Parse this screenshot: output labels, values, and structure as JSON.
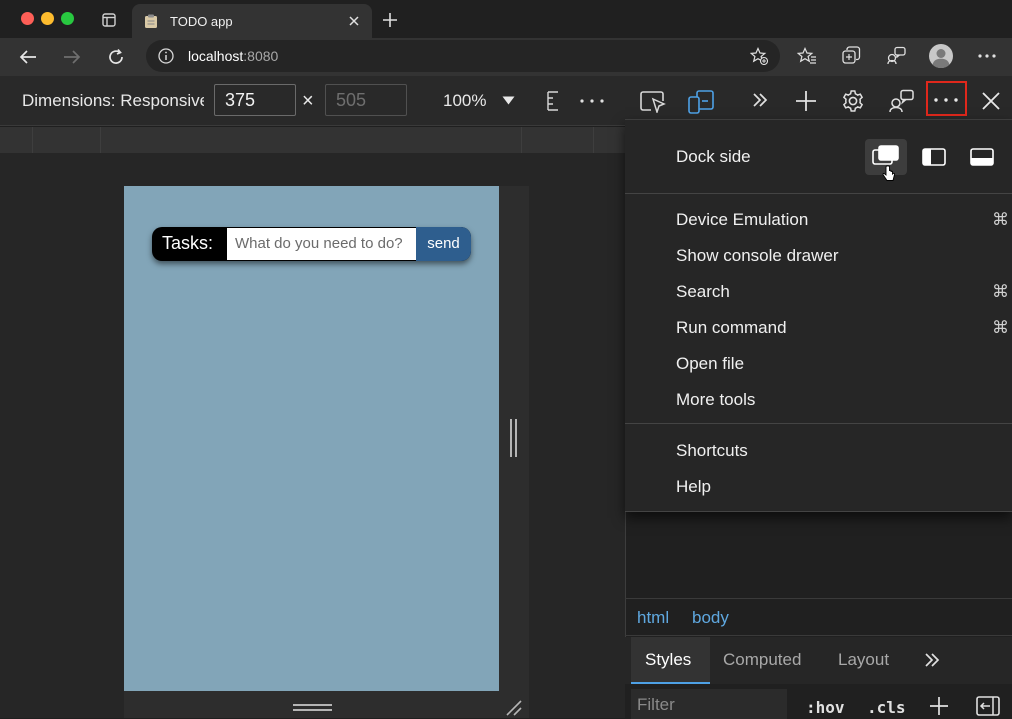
{
  "browser": {
    "tab_title": "TODO app",
    "url_host": "localhost",
    "url_port": ":8080"
  },
  "device_toolbar": {
    "dimensions_label": "Dimensions: Responsive",
    "width_value": "375",
    "height_value": "505",
    "times_symbol": "×",
    "zoom": "100%"
  },
  "app": {
    "tasks_label": "Tasks:",
    "input_placeholder": "What do you need to do?",
    "send_label": "send",
    "background_color": "#82a5b8",
    "send_color": "#2e5e8e"
  },
  "devtools_menu": {
    "dock_side_label": "Dock side",
    "items": [
      {
        "label": "Device Emulation",
        "shortcut": "⌘"
      },
      {
        "label": "Show console drawer",
        "shortcut": ""
      },
      {
        "label": "Search",
        "shortcut": "⌘"
      },
      {
        "label": "Run command",
        "shortcut": "⌘"
      },
      {
        "label": "Open file",
        "shortcut": ""
      },
      {
        "label": "More tools",
        "shortcut": ""
      }
    ],
    "items2": [
      {
        "label": "Shortcuts"
      },
      {
        "label": "Help"
      }
    ],
    "highlight_color": "#e0281c"
  },
  "elements_panel": {
    "breadcrumbs": [
      "html",
      "body"
    ],
    "tabs": [
      "Styles",
      "Computed",
      "Layout"
    ],
    "filter_placeholder": "Filter",
    "hov_label": ":hov",
    "cls_label": ".cls"
  }
}
